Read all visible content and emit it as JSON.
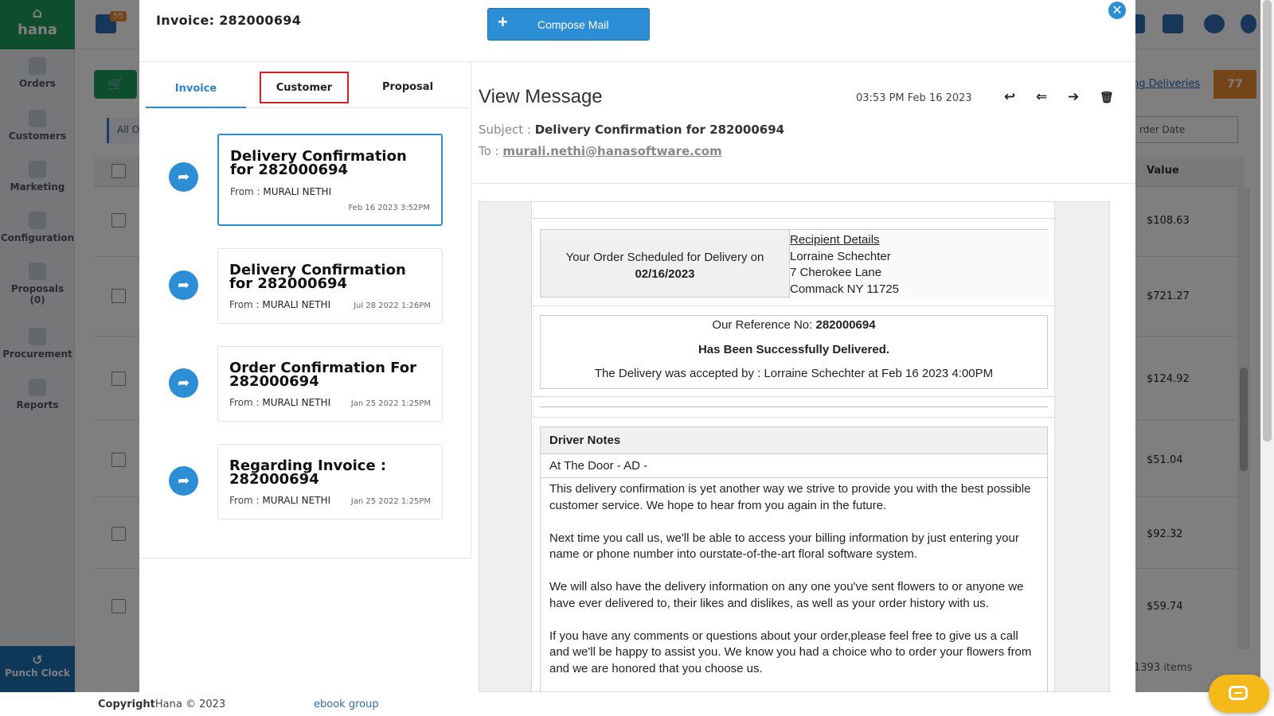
{
  "background": {
    "logo": "hana",
    "notification_count": "55",
    "nav": [
      {
        "label": "Orders",
        "icon": "orders-icon"
      },
      {
        "label": "Customers",
        "icon": "customers-icon"
      },
      {
        "label": "Marketing",
        "icon": "marketing-icon"
      },
      {
        "label": "Configuration",
        "icon": "gear-icon"
      },
      {
        "label": "Proposals",
        "sub": "(0)",
        "icon": "proposals-icon"
      },
      {
        "label": "Procurement",
        "icon": "procurement-icon"
      },
      {
        "label": "Reports",
        "icon": "reports-icon"
      }
    ],
    "punch_clock": "Punch Clock",
    "filter_tab": "All O",
    "deliveries_link": "ng Deliveries",
    "deliveries_count": "77",
    "sort_select": "rder Date",
    "value_header": "Value",
    "values": [
      "$108.63",
      "$721.27",
      "$124.92",
      "$51.04",
      "$92.32",
      "$59.74"
    ],
    "items_count": "1393 items"
  },
  "footer": {
    "copyright_label": "Copyright",
    "copyright_text": "Hana © 2023",
    "link": "ebook group"
  },
  "modal": {
    "title": "Invoice: 282000694",
    "compose_label": "Compose Mail",
    "tabs": [
      "Invoice",
      "Customer",
      "Proposal"
    ],
    "active_tab": "Invoice",
    "highlighted_tab": "Customer",
    "mails": [
      {
        "subject": "Delivery Confirmation for 282000694",
        "from_label": "From :",
        "from": "MURALI NETHI",
        "date": "Feb 16 2023 3:52PM"
      },
      {
        "subject": "Delivery Confirmation for 282000694",
        "from_label": "From :",
        "from": "MURALI NETHI",
        "date": "Jul 28 2022 1:26PM"
      },
      {
        "subject": "Order Confirmation For 282000694",
        "from_label": "From :",
        "from": "MURALI NETHI",
        "date": "Jan 25 2022 1:25PM"
      },
      {
        "subject": "Regarding Invoice : 282000694",
        "from_label": "From :",
        "from": "MURALI NETHI",
        "date": "Jan 25 2022 1:25PM"
      }
    ],
    "view": {
      "title": "View Message",
      "time": "03:53 PM Feb 16 2023",
      "subject_label": "Subject :",
      "subject": "Delivery Confirmation for 282000694",
      "to_label": "To :",
      "to": "murali.nethi@hanasoftware.com"
    },
    "message": {
      "scheduled_text": "Your Order Scheduled for Delivery on",
      "scheduled_date": "02/16/2023",
      "recipient_heading": "Recipient Details",
      "recipient_name": "Lorraine Schechter",
      "recipient_street": "7 Cherokee Lane",
      "recipient_city": "Commack NY 11725",
      "reference_label": "Our Reference No:",
      "reference_no": "282000694",
      "delivered_text": "Has Been Successfully Delivered.",
      "accepted_text": "The Delivery was accepted by : Lorraine Schechter at Feb 16 2023 4:00PM",
      "driver_notes_heading": "Driver Notes",
      "driver_note": "At The Door - AD -",
      "paragraphs": [
        "This delivery confirmation is yet another way we strive to provide you with the best possible customer service. We hope to hear from you again in the future.",
        "Next time you call us, we'll be able to access your billing information by just entering your name or phone number into ourstate-of-the-art floral software system.",
        "We will also have the delivery information on any one you've sent flowers to or anyone we have ever delivered to, their likes and dislikes, as well as your order history with us.",
        "If you have any comments or questions about your order,please feel free to give us a call and we'll be happy to assist you. We know you had a choice who to order your flowers from and we are honored that you choose us."
      ]
    }
  },
  "colors": {
    "accent": "#2c8fd6",
    "brand_green": "#1f9c5a",
    "orange": "#e68a2e",
    "highlight_red": "#d62020"
  }
}
